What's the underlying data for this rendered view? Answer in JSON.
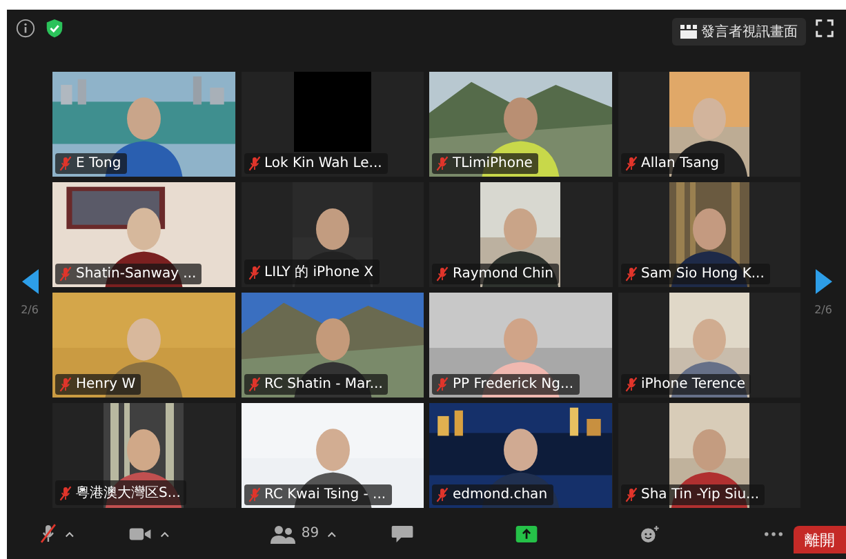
{
  "top_bar": {
    "view_button": "發言者視訊畫面"
  },
  "pager": {
    "previous": "2/6",
    "next": "2/6"
  },
  "tiles": [
    {
      "name": "E Tong",
      "muted": true,
      "kind": "wide"
    },
    {
      "name": "Lok Kin Wah Le...",
      "muted": true,
      "kind": "blank"
    },
    {
      "name": "TLimiPhone",
      "muted": true,
      "kind": "wide"
    },
    {
      "name": "Allan Tsang",
      "muted": true,
      "kind": "narrow"
    },
    {
      "name": "Shatin-Sanway ...",
      "muted": true,
      "kind": "wide"
    },
    {
      "name": "LILY 的 iPhone X",
      "muted": true,
      "kind": "narrow"
    },
    {
      "name": "Raymond Chin",
      "muted": true,
      "kind": "narrow"
    },
    {
      "name": "Sam Sio Hong K...",
      "muted": true,
      "kind": "narrow"
    },
    {
      "name": "Henry W",
      "muted": true,
      "kind": "wide"
    },
    {
      "name": "RC Shatin - Mar...",
      "muted": true,
      "kind": "wide"
    },
    {
      "name": "PP Frederick Ng...",
      "muted": true,
      "kind": "wide"
    },
    {
      "name": "iPhone Terence",
      "muted": true,
      "kind": "narrow"
    },
    {
      "name": "粵港澳大灣区S...",
      "muted": true,
      "kind": "narrow"
    },
    {
      "name": "RC Kwai Tsing - ...",
      "muted": true,
      "kind": "wide"
    },
    {
      "name": "edmond.chan",
      "muted": true,
      "kind": "wide"
    },
    {
      "name": "Sha Tin -Yip Siu...",
      "muted": true,
      "kind": "narrow"
    }
  ],
  "toolbar": {
    "mic_muted": true,
    "participants_count": "89",
    "leave_button": "離開"
  }
}
